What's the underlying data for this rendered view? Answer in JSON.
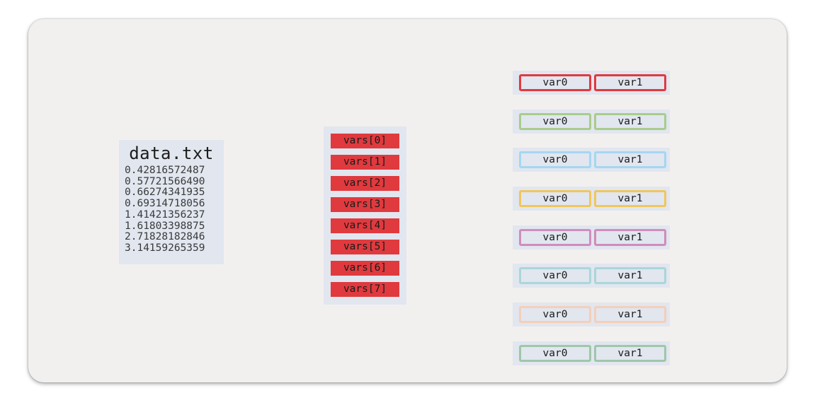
{
  "file": {
    "title": "data.txt",
    "lines": [
      "0.42816572487",
      "0.57721566490",
      "0.66274341935",
      "0.69314718056",
      "1.41421356237",
      "1.61803398875",
      "2.71828182846",
      "3.14159265359"
    ]
  },
  "vars": {
    "cells": [
      "vars[0]",
      "vars[1]",
      "vars[2]",
      "vars[3]",
      "vars[4]",
      "vars[5]",
      "vars[6]",
      "vars[7]"
    ],
    "cell_color": "#e03a3e"
  },
  "pairs": {
    "rows": [
      {
        "var0": "var0",
        "var1": "var1",
        "color": "#e03a3e"
      },
      {
        "var0": "var0",
        "var1": "var1",
        "color": "#a9cc8c"
      },
      {
        "var0": "var0",
        "var1": "var1",
        "color": "#a6d6f2"
      },
      {
        "var0": "var0",
        "var1": "var1",
        "color": "#f1c65a"
      },
      {
        "var0": "var0",
        "var1": "var1",
        "color": "#cf8dbc"
      },
      {
        "var0": "var0",
        "var1": "var1",
        "color": "#a9d6da"
      },
      {
        "var0": "var0",
        "var1": "var1",
        "color": "#f5cfb8"
      },
      {
        "var0": "var0",
        "var1": "var1",
        "color": "#9fc7a9"
      }
    ]
  }
}
